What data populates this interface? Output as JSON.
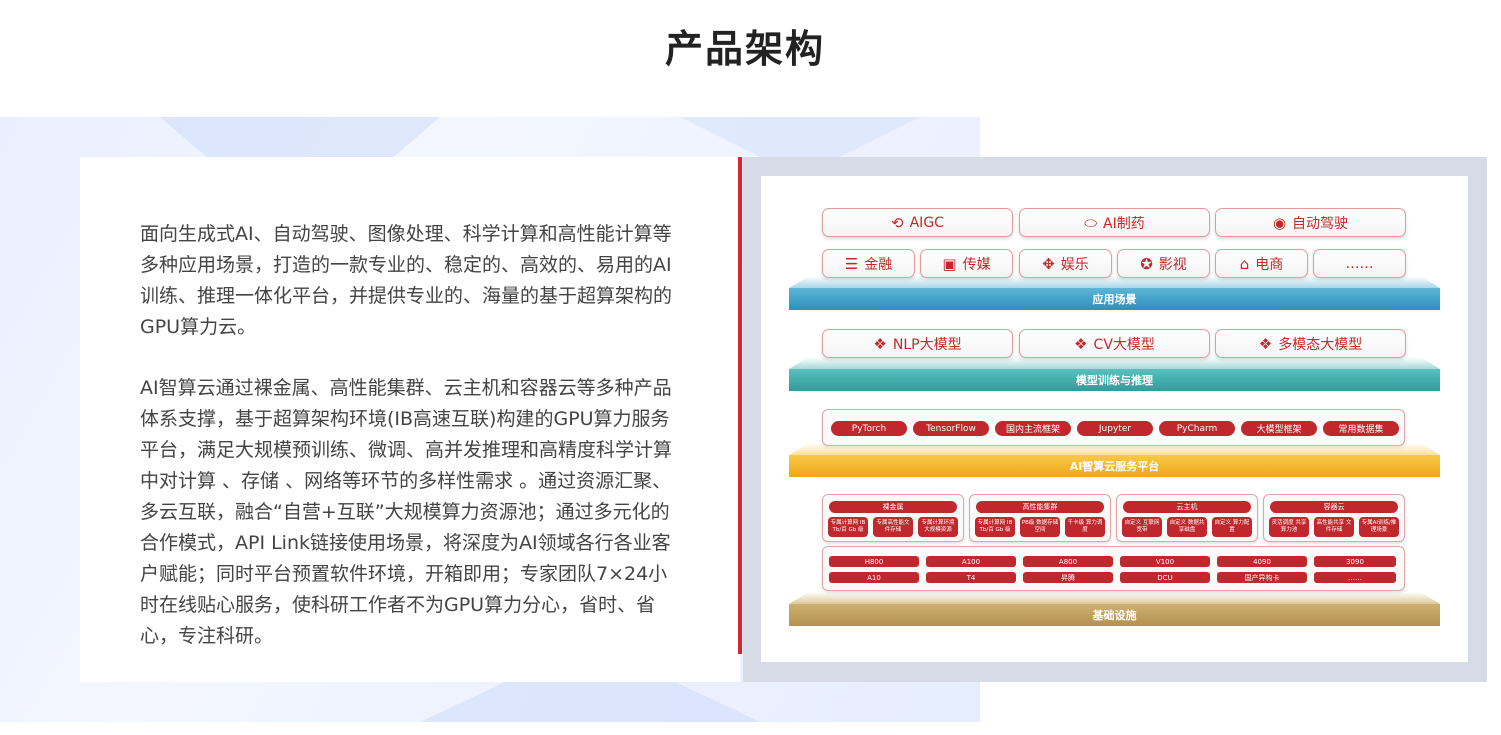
{
  "page_title": "产品架构",
  "intro": {
    "paragraph1": "面向生成式AI、自动驾驶、图像处理、科学计算和高性能计算等多种应用场景，打造的一款专业的、稳定的、高效的、易用的AI训练、推理一体化平台，并提供专业的、海量的基于超算架构的GPU算力云。",
    "paragraph2": "AI智算云通过裸金属、高性能集群、云主机和容器云等多种产品体系支撑，基于超算架构环境(IB高速互联)构建的GPU算力服务平台，满足大规模预训练、微调、高并发推理和高精度科学计算中对计算 、存储 、网络等环节的多样性需求 。通过资源汇聚、多云互联，融合“自营+互联”大规模算力资源池；通过多元化的合作模式，API Link链接使用场景，将深度为AI领域各行各业客户赋能；同时平台预置软件环境，开箱即用；专家团队7×24小时在线贴心服务，使科研工作者不为GPU算力分心，省时、省心，专注科研。"
  },
  "diagram": {
    "scenarios_top": [
      {
        "label": "AIGC",
        "icon": "ai-chip-icon"
      },
      {
        "label": "AI制药",
        "icon": "pill-capsule-icon"
      },
      {
        "label": "自动驾驶",
        "icon": "steering-wheel-icon"
      }
    ],
    "scenarios_bottom": [
      {
        "label": "金融",
        "icon": "coin-stack-icon"
      },
      {
        "label": "传媒",
        "icon": "media-screen-icon"
      },
      {
        "label": "娱乐",
        "icon": "gamepad-icon"
      },
      {
        "label": "影视",
        "icon": "film-reel-icon"
      },
      {
        "label": "电商",
        "icon": "shop-icon"
      },
      {
        "label": "……",
        "icon": ""
      }
    ],
    "layer_app": "应用场景",
    "models": [
      {
        "label": "NLP大模型",
        "icon": "cubes-icon"
      },
      {
        "label": "CV大模型",
        "icon": "cubes-icon"
      },
      {
        "label": "多模态大模型",
        "icon": "cubes-icon"
      }
    ],
    "layer_model": "模型训练与推理",
    "frameworks": [
      "PyTorch",
      "TensorFlow",
      "国内主流框架",
      "Jupyter",
      "PyCharm",
      "大模型框架",
      "常用数据集"
    ],
    "layer_platform": "AI智算云服务平台",
    "services": [
      {
        "title": "裸金属",
        "subs": [
          "专属计算网 IB Tb/百 Gb 级",
          "专属高性能文件存储",
          "专属计算环境 大规模资源"
        ]
      },
      {
        "title": "高性能集群",
        "subs": [
          "专属计算网 IB Tb/百 Gb 级",
          "PB级 数据存储空间",
          "千卡级 算力调度"
        ]
      },
      {
        "title": "云主机",
        "subs": [
          "自定义 互联网宽带",
          "自定义 数据共享磁盘",
          "自定义 算力配置"
        ]
      },
      {
        "title": "容器云",
        "subs": [
          "灵活调度 共享算力池",
          "高性能共享 文件存储",
          "专属AI训练/推理场景"
        ]
      }
    ],
    "hardware_row1": [
      "H800",
      "A100",
      "A800",
      "V100",
      "4090",
      "3090"
    ],
    "hardware_row2": [
      "A10",
      "T4",
      "昇腾",
      "DCU",
      "国产异构卡",
      "……"
    ],
    "layer_infra": "基础设施",
    "colors": {
      "accent": "#c0282d",
      "app_band": "#2e8fbd",
      "model_band": "#2f9c9b",
      "platform_band": "#f0a719",
      "infra_band": "#b4924f"
    }
  }
}
